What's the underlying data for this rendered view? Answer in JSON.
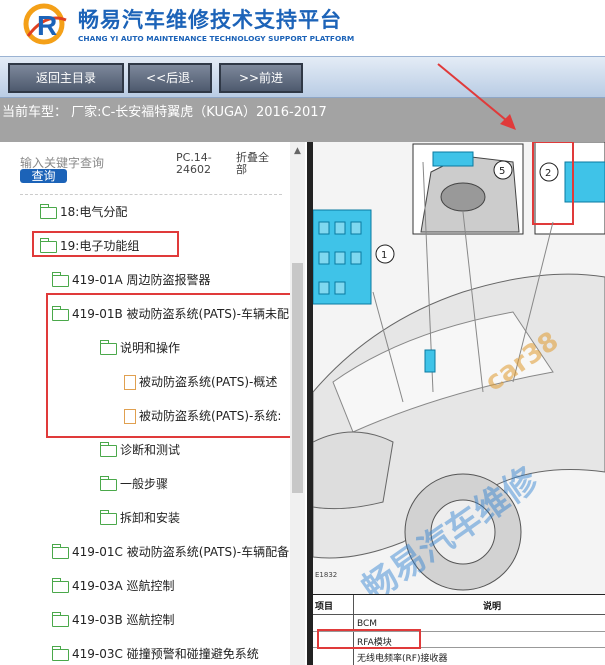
{
  "header": {
    "title": "畅易汽车维修技术支持平台",
    "subtitle": "CHANG YI AUTO MAINTENANCE TECHNOLOGY SUPPORT PLATFORM"
  },
  "nav": {
    "home": "返回主目录",
    "back": "<<后退.",
    "forward": ">>前进"
  },
  "current_model": "当前车型： 厂家:C-长安福特翼虎（KUGA）2016-2017",
  "sidebar": {
    "search_placeholder": "输入关键字查询",
    "search_button": "查询",
    "pc_code": "PC.14-24602",
    "collapse_all": "折叠全部",
    "tree": [
      {
        "label": "18:电气分配",
        "type": "folder"
      },
      {
        "label": "19:电子功能组",
        "type": "folder-open"
      },
      {
        "label": "419-01A 周边防盗报警器",
        "type": "folder"
      },
      {
        "label": "419-01B 被动防盗系统(PATS)-车辆未配",
        "type": "folder-open"
      },
      {
        "label": "说明和操作",
        "type": "folder-open"
      },
      {
        "label": "被动防盗系统(PATS)-概述",
        "type": "doc"
      },
      {
        "label": "被动防盗系统(PATS)-系统:",
        "type": "doc"
      },
      {
        "label": "诊断和测试",
        "type": "folder"
      },
      {
        "label": "一般步骤",
        "type": "folder"
      },
      {
        "label": "拆卸和安装",
        "type": "folder"
      },
      {
        "label": "419-01C 被动防盗系统(PATS)-车辆配备",
        "type": "folder"
      },
      {
        "label": "419-03A 巡航控制",
        "type": "folder"
      },
      {
        "label": "419-03B 巡航控制",
        "type": "folder"
      },
      {
        "label": "419-03C 碰撞预警和碰撞避免系统",
        "type": "folder"
      }
    ]
  },
  "diagram": {
    "callouts": [
      "1",
      "2",
      "5"
    ],
    "figure_code": "E1832",
    "watermark": "畅易汽车维修",
    "watermark_url": "car38",
    "table": {
      "col1": "项目",
      "col2": "说明",
      "rows": [
        "BCM",
        "RFA模块",
        "无线电频率(RF)接收器"
      ]
    }
  },
  "colors": {
    "brand": "#1c63b8",
    "highlight": "#e03a3a",
    "folder": "#4aa84a",
    "doc": "#e0a050"
  }
}
